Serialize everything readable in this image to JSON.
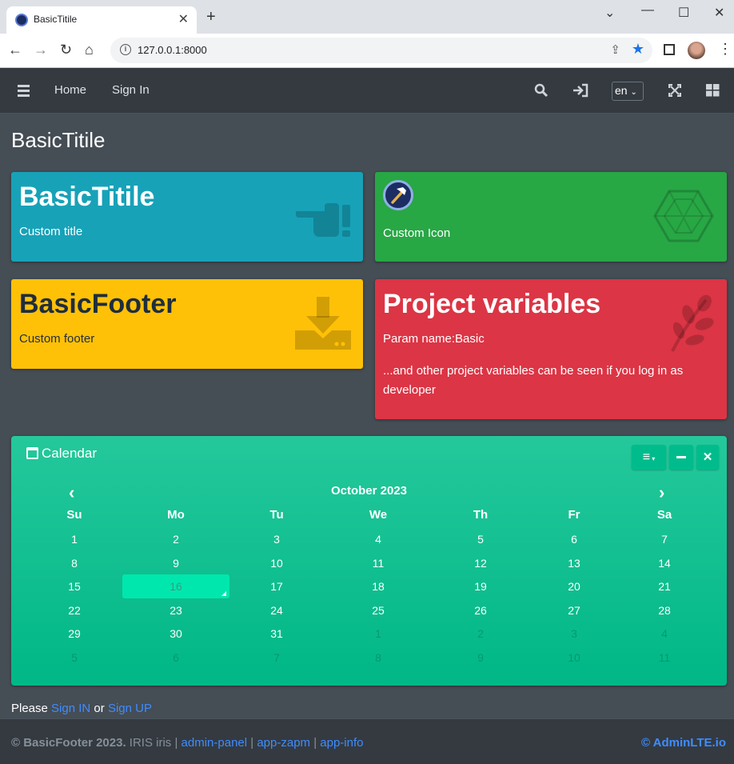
{
  "browser": {
    "tab_title": "BasicTitile",
    "url": "127.0.0.1:8000"
  },
  "navbar": {
    "home_label": "Home",
    "signin_label": "Sign In",
    "language": "en"
  },
  "page": {
    "title": "BasicTitile"
  },
  "boxes": [
    {
      "title": "BasicTitile",
      "text": "Custom title",
      "color": "#17a2b8",
      "icon": "hand-point-icon"
    },
    {
      "title": "",
      "text": "Custom Icon",
      "color": "#28a745",
      "icon": "hexagon-icon"
    },
    {
      "title": "BasicFooter",
      "text": "Custom footer",
      "color": "#ffc107",
      "icon": "download-icon"
    },
    {
      "title": "Project variables",
      "text": "Param name:Basic",
      "text2": "...and other project variables can be seen if you log in as developer",
      "color": "#dc3545",
      "icon": "leaf-icon"
    }
  ],
  "calendar": {
    "title": "Calendar",
    "month_label": "October 2023",
    "weekdays": [
      "Su",
      "Mo",
      "Tu",
      "We",
      "Th",
      "Fr",
      "Sa"
    ],
    "weeks": [
      [
        "1",
        "2",
        "3",
        "4",
        "5",
        "6",
        "7"
      ],
      [
        "8",
        "9",
        "10",
        "11",
        "12",
        "13",
        "14"
      ],
      [
        "15",
        "16",
        "17",
        "18",
        "19",
        "20",
        "21"
      ],
      [
        "22",
        "23",
        "24",
        "25",
        "26",
        "27",
        "28"
      ],
      [
        "29",
        "30",
        "31",
        "1",
        "2",
        "3",
        "4"
      ],
      [
        "5",
        "6",
        "7",
        "8",
        "9",
        "10",
        "11"
      ]
    ],
    "selected_day": "16"
  },
  "signin_line": {
    "prefix": "Please ",
    "signin": "Sign IN",
    "or": " or ",
    "signup": "Sign UP"
  },
  "footer": {
    "copyright": "© BasicFooter 2023.",
    "org": " IRIS iris | ",
    "links": [
      "admin-panel",
      "app-zapm",
      "app-info"
    ],
    "brand": "© AdminLTE.io"
  }
}
